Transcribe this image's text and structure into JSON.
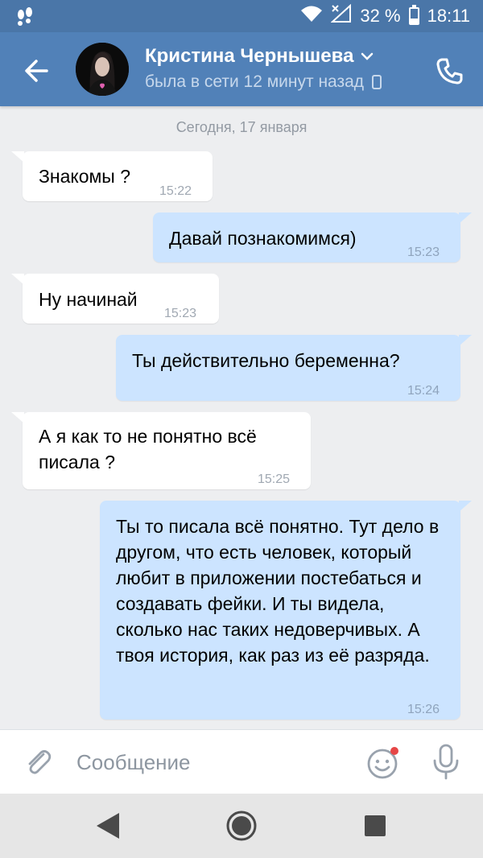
{
  "colors": {
    "header": "#5181b8",
    "status_bar": "#4a76a8",
    "bubble_in": "#ffffff",
    "bubble_out": "#cce4ff",
    "background": "#edeef0",
    "unread_dot": "#e64646"
  },
  "status_bar": {
    "battery": "32 %",
    "battery_level": 0.32,
    "time": "18:11"
  },
  "header": {
    "name": "Кристина Чернышева",
    "last_seen": "была в сети 12 минут назад",
    "icons": {
      "back": "arrow-left-icon",
      "call": "phone-icon",
      "dropdown": "chevron-down-icon",
      "device": "mobile-icon"
    }
  },
  "chat": {
    "date": "Сегодня, 17 января",
    "messages": [
      {
        "direction": "in",
        "text": "Знакомы ?",
        "time": "15:22"
      },
      {
        "direction": "out",
        "text": "Давай познакомимся)",
        "time": "15:23"
      },
      {
        "direction": "in",
        "text": "Ну начинай",
        "time": "15:23"
      },
      {
        "direction": "out",
        "text": "Ты действительно беременна?",
        "time": "15:24"
      },
      {
        "direction": "in",
        "text": "А я как то не понятно всё писала ?",
        "time": "15:25"
      },
      {
        "direction": "out",
        "text": "Ты то писала всё понятно. Тут дело в другом, что есть человек, который любит в приложении постебаться и создавать фейки. И ты видела, сколько нас таких недоверчивых. А твоя история, как раз из её разряда.",
        "time": "15:26"
      }
    ]
  },
  "input": {
    "placeholder": "Сообщение",
    "value": "",
    "icons": {
      "attach": "paperclip-icon",
      "emoji": "emoji-icon",
      "mic": "microphone-icon"
    }
  },
  "nav": {
    "icons": {
      "back": "nav-back-icon",
      "home": "nav-home-icon",
      "recents": "nav-recents-icon"
    }
  }
}
